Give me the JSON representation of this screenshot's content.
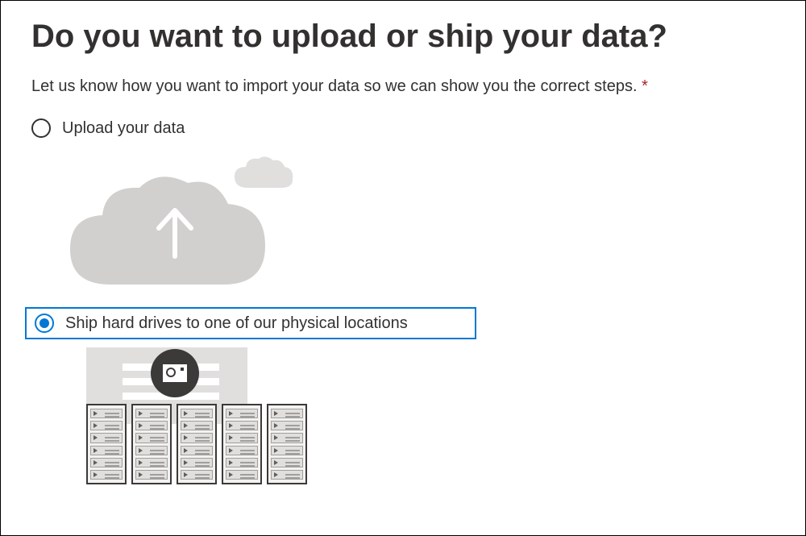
{
  "heading": "Do you want to upload or ship your data?",
  "subtitle": "Let us know how you want to import your data so we can show you the correct steps.",
  "required_mark": "*",
  "options": [
    {
      "label": "Upload your data",
      "selected": false
    },
    {
      "label": "Ship hard drives to one of our physical locations",
      "selected": true
    }
  ]
}
